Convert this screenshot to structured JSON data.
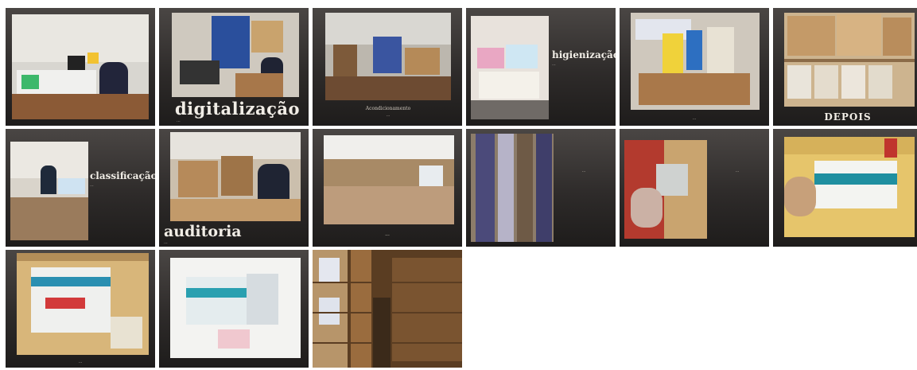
{
  "slides": [
    {
      "id": "s1",
      "caption": ""
    },
    {
      "id": "s2",
      "caption": "digitalização",
      "subcaption": "..."
    },
    {
      "id": "s3",
      "caption": "Acondicionamento",
      "subcaption": "..."
    },
    {
      "id": "s4",
      "caption": "higienização",
      "subcaption": "..."
    },
    {
      "id": "s5",
      "caption": "..."
    },
    {
      "id": "s6",
      "caption": "DEPOIS"
    },
    {
      "id": "s7",
      "caption": "classificação",
      "subcaption": "..."
    },
    {
      "id": "s8",
      "caption": "auditoria",
      "subcaption": "..."
    },
    {
      "id": "s9",
      "caption": "..."
    },
    {
      "id": "s10",
      "caption": "..."
    },
    {
      "id": "s11",
      "caption": "..."
    },
    {
      "id": "s12",
      "caption": ""
    },
    {
      "id": "s13",
      "caption": "..."
    },
    {
      "id": "s14",
      "caption": ""
    },
    {
      "id": "s15",
      "caption": ""
    }
  ]
}
